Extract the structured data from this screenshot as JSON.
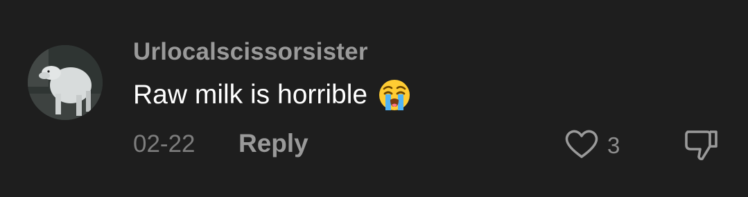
{
  "comment": {
    "username": "Urlocalscissorsister",
    "text": "Raw milk is horrible",
    "emoji": "loudly-crying-face-emoji",
    "date": "02-22",
    "reply_label": "Reply",
    "like_count": "3",
    "icons": {
      "like": "heart-icon",
      "dislike": "thumbs-down-icon"
    }
  },
  "colors": {
    "background": "#1e1e1e",
    "username": "#9a9a9a",
    "text": "#ffffff",
    "meta": "#7d7d7d"
  }
}
